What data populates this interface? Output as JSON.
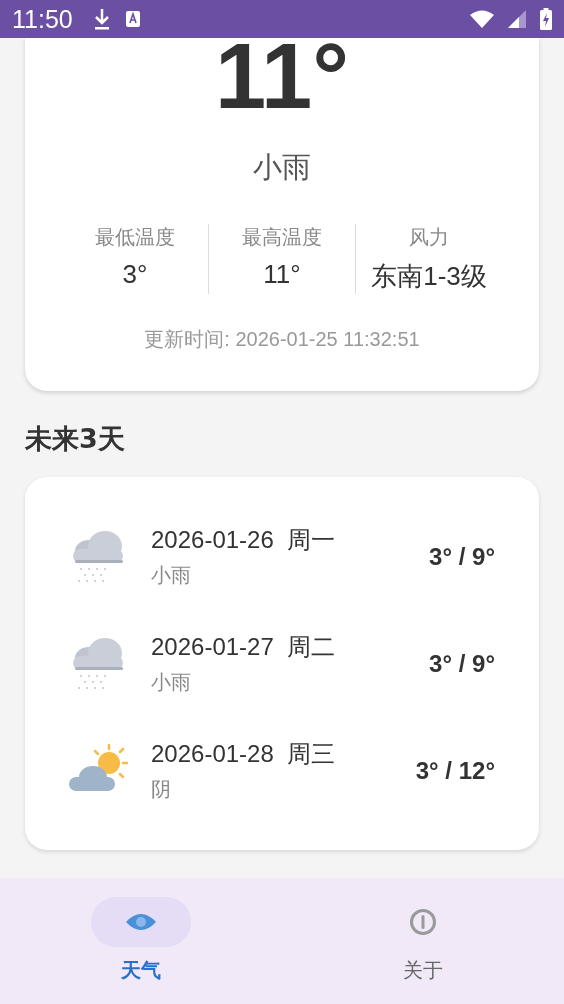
{
  "status_bar": {
    "time": "11:50"
  },
  "current": {
    "temperature": "11°",
    "condition": "小雨",
    "stats": [
      {
        "label": "最低温度",
        "value": "3°"
      },
      {
        "label": "最高温度",
        "value": "11°"
      },
      {
        "label": "风力",
        "value": "东南1-3级"
      }
    ],
    "updated": "更新时间: 2026-01-25 11:32:51"
  },
  "forecast": {
    "title": "未来3天",
    "days": [
      {
        "date": "2026-01-26",
        "weekday": "周一",
        "condition": "小雨",
        "range": "3° / 9°",
        "kind": "rain"
      },
      {
        "date": "2026-01-27",
        "weekday": "周二",
        "condition": "小雨",
        "range": "3° / 9°",
        "kind": "rain"
      },
      {
        "date": "2026-01-28",
        "weekday": "周三",
        "condition": "阴",
        "range": "3° / 12°",
        "kind": "partly_cloudy"
      }
    ]
  },
  "bottom_nav": [
    {
      "label": "天气",
      "selected": true,
      "kind": "eye"
    },
    {
      "label": "关于",
      "selected": false,
      "kind": "info"
    }
  ]
}
